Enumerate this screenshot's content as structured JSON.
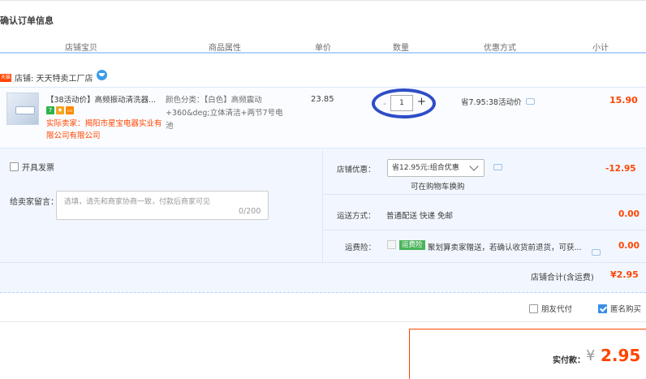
{
  "page_title": "确认订单信息",
  "columns": [
    "店铺宝贝",
    "商品属性",
    "单价",
    "数量",
    "优惠方式",
    "小计"
  ],
  "shop": {
    "badge": "天猫",
    "label": "店铺: 天天特卖工厂店"
  },
  "item": {
    "name": "【38活动价】高频振动清洗器...",
    "seller_label": "实际卖家：",
    "seller_name": "揭阳市星宝电器实业有限公司有限公司",
    "attributes": "颜色分类：【白色】高频震动+360&deg;立体清洁+两节7号电池",
    "unit_price": "23.85",
    "quantity": "1",
    "qty_minus": "-",
    "qty_plus": "+",
    "promotion": "省7.95:38活动价",
    "subtotal": "15.90",
    "badge_colors": [
      "#2fb24c",
      "#f5a623",
      "#ff8a00"
    ]
  },
  "invoice": {
    "label": "开具发票",
    "checked": false
  },
  "message": {
    "label": "给卖家留言：",
    "placeholder": "选填，请先和商家协商一致，付款后商家可见",
    "counter": "0/200"
  },
  "shop_discount": {
    "label": "店铺优惠：",
    "selected": "省12.95元:组合优惠",
    "note": "可在购物车换购",
    "value": "-12.95"
  },
  "shipping": {
    "label": "运送方式：",
    "method": "普通配送 快递 免邮",
    "value": "0.00"
  },
  "insurance": {
    "label": "运费险：",
    "tag": "运费险",
    "text": "聚划算卖家赠送，若确认收货前退货，可获...",
    "value": "0.00"
  },
  "shop_total": {
    "label": "店铺合计(含运费)",
    "value": "¥2.95"
  },
  "options": {
    "friend_pay": "朋友代付",
    "anonymous": "匿名购买"
  },
  "payment": {
    "label": "实付款：",
    "currency": "¥",
    "amount": "2.95"
  },
  "colors": {
    "accent": "#ff4400",
    "header_line": "#b2d1ff",
    "annotation_ring": "#2e4dc6"
  }
}
